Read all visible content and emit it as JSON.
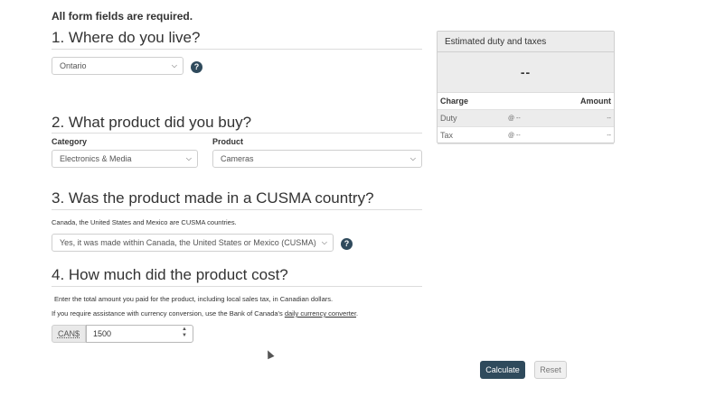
{
  "form": {
    "required_note": "All form fields are required."
  },
  "section1": {
    "title": "1. Where do you live?",
    "province": "Ontario",
    "help": "?"
  },
  "section2": {
    "title": "2. What product did you buy?",
    "category_label": "Category",
    "category_value": "Electronics & Media",
    "product_label": "Product",
    "product_value": "Cameras"
  },
  "section3": {
    "title": "3. Was the product made in a CUSMA country?",
    "note": "Canada, the United States and Mexico are CUSMA countries.",
    "origin_value": "Yes, it was made within Canada, the United States or Mexico (CUSMA)",
    "help": "?"
  },
  "section4": {
    "title": "4. How much did the product cost?",
    "note1": "Enter the total amount you paid for the product, including local sales tax, in Canadian dollars.",
    "note2_prefix": "If you require assistance with currency conversion, use the Bank of Canada's ",
    "note2_link": "daily currency converter",
    "note2_suffix": ".",
    "currency_prefix": "CAN$",
    "amount_value": "1500"
  },
  "buttons": {
    "calculate": "Calculate",
    "reset": "Reset"
  },
  "estimate": {
    "title": "Estimated duty and taxes",
    "total": "--",
    "col_charge": "Charge",
    "col_amount": "Amount",
    "rows": [
      {
        "charge": "Duty",
        "rate": "@ --",
        "amount": "--"
      },
      {
        "charge": "Tax",
        "rate": "@ --",
        "amount": "--"
      }
    ]
  },
  "icons": [
    "help-icon",
    "chevron-down-icon",
    "spinner-icon",
    "mouse-cursor-icon"
  ]
}
